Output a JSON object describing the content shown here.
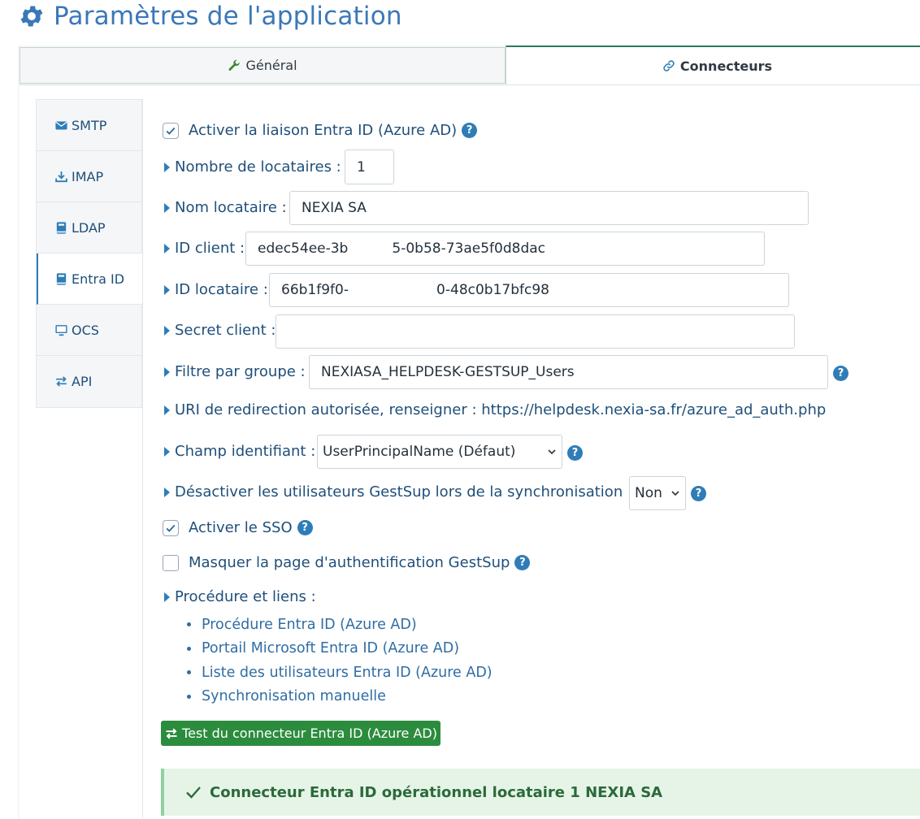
{
  "page": {
    "title": "Paramètres de l'application"
  },
  "tabs": {
    "general": "Général",
    "connectors": "Connecteurs"
  },
  "sidebar": {
    "items": [
      {
        "label": "SMTP",
        "icon": "envelope-icon"
      },
      {
        "label": "IMAP",
        "icon": "download-icon"
      },
      {
        "label": "LDAP",
        "icon": "book-icon"
      },
      {
        "label": "Entra ID",
        "icon": "book-icon"
      },
      {
        "label": "OCS",
        "icon": "desktop-icon"
      },
      {
        "label": "API",
        "icon": "exchange-icon"
      }
    ],
    "active": "Entra ID"
  },
  "form": {
    "enable_link_label": "Activer la liaison Entra ID (Azure AD)",
    "enable_link_checked": true,
    "tenant_count_label": "Nombre de locataires :",
    "tenant_count_value": "1",
    "tenant_name_label": "Nom locataire :",
    "tenant_name_value": "NEXIA SA",
    "client_id_label": "ID client :",
    "client_id_value": "edec54ee-3b          5-0b58-73ae5f0d8dac",
    "tenant_id_label": "ID locataire :",
    "tenant_id_value": "66b1f9f0-                    0-48c0b17bfc98",
    "secret_label": "Secret client :",
    "secret_value": "",
    "group_filter_label": "Filtre par groupe :",
    "group_filter_value": "NEXIASA_HELPDESK-GESTSUP_Users",
    "redirect_uri_label": "URI de redirection autorisée, renseigner : https://helpdesk.nexia-sa.fr/azure_ad_auth.php",
    "identifier_label": "Champ identifiant :",
    "identifier_value": "UserPrincipalName (Défaut)",
    "disable_users_label": "Désactiver les utilisateurs GestSup lors de la synchronisation :",
    "disable_users_value": "Non",
    "sso_label": "Activer le SSO",
    "sso_checked": true,
    "hide_auth_label": "Masquer la page d'authentification GestSup",
    "hide_auth_checked": false,
    "procedures_label": "Procédure et liens :"
  },
  "links": [
    "Procédure Entra ID (Azure AD)",
    "Portail Microsoft Entra ID (Azure AD)",
    "Liste des utilisateurs Entra ID (Azure AD)",
    "Synchronisation manuelle"
  ],
  "test_button": "Test du connecteur Entra ID (Azure AD)",
  "alert": {
    "text": "Connecteur Entra ID opérationnel locataire 1 NEXIA SA",
    "type": "success"
  },
  "colors": {
    "accent": "#2f7db7",
    "success_button": "#2c8c3d",
    "success_bg": "#e6f4e8",
    "success_text": "#2b6a39"
  }
}
